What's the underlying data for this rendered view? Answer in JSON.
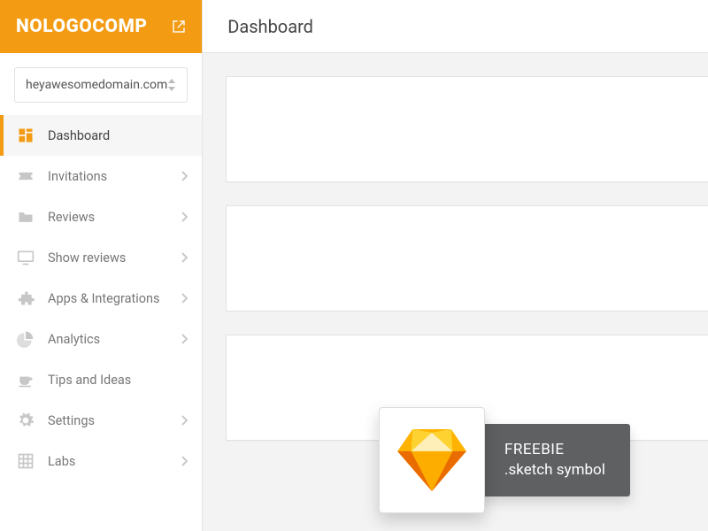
{
  "brand": "NOLOGOCOMP",
  "domain_selector": {
    "value": "heyawesomedomain.com"
  },
  "page_title": "Dashboard",
  "nav": [
    {
      "label": "Dashboard",
      "icon": "dashboard",
      "active": true,
      "expandable": false
    },
    {
      "label": "Invitations",
      "icon": "ticket",
      "active": false,
      "expandable": true
    },
    {
      "label": "Reviews",
      "icon": "folder",
      "active": false,
      "expandable": true
    },
    {
      "label": "Show reviews",
      "icon": "screen",
      "active": false,
      "expandable": true
    },
    {
      "label": "Apps & Integrations",
      "icon": "puzzle",
      "active": false,
      "expandable": true
    },
    {
      "label": "Analytics",
      "icon": "piechart",
      "active": false,
      "expandable": true
    },
    {
      "label": "Tips and Ideas",
      "icon": "coffee",
      "active": false,
      "expandable": false
    },
    {
      "label": "Settings",
      "icon": "gear",
      "active": false,
      "expandable": true
    },
    {
      "label": "Labs",
      "icon": "grid",
      "active": false,
      "expandable": true
    }
  ],
  "freebie": {
    "line1": "FREEBIE",
    "line2": ".sketch symbol"
  },
  "colors": {
    "accent": "#f39b12",
    "icon_muted": "#c7c7c7",
    "text": "#555"
  }
}
